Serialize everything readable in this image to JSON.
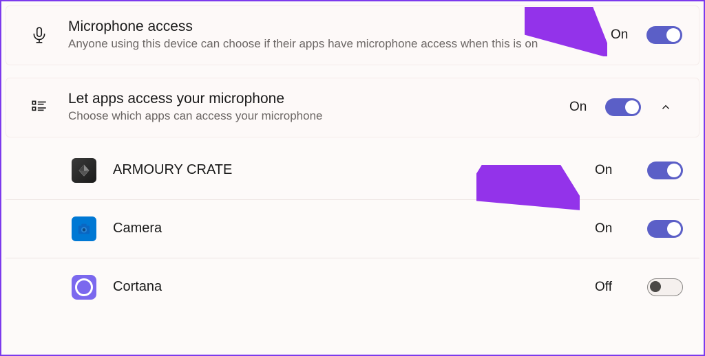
{
  "mic_access": {
    "title": "Microphone access",
    "subtitle": "Anyone using this device can choose if their apps have microphone access when this is on",
    "status": "On",
    "toggled": true
  },
  "apps_access": {
    "title": "Let apps access your microphone",
    "subtitle": "Choose which apps can access your microphone",
    "status": "On",
    "toggled": true,
    "expanded": true
  },
  "apps": [
    {
      "name": "ARMOURY CRATE",
      "status": "On",
      "toggled": true,
      "icon": "armoury"
    },
    {
      "name": "Camera",
      "status": "On",
      "toggled": true,
      "icon": "camera"
    },
    {
      "name": "Cortana",
      "status": "Off",
      "toggled": false,
      "icon": "cortana"
    }
  ]
}
